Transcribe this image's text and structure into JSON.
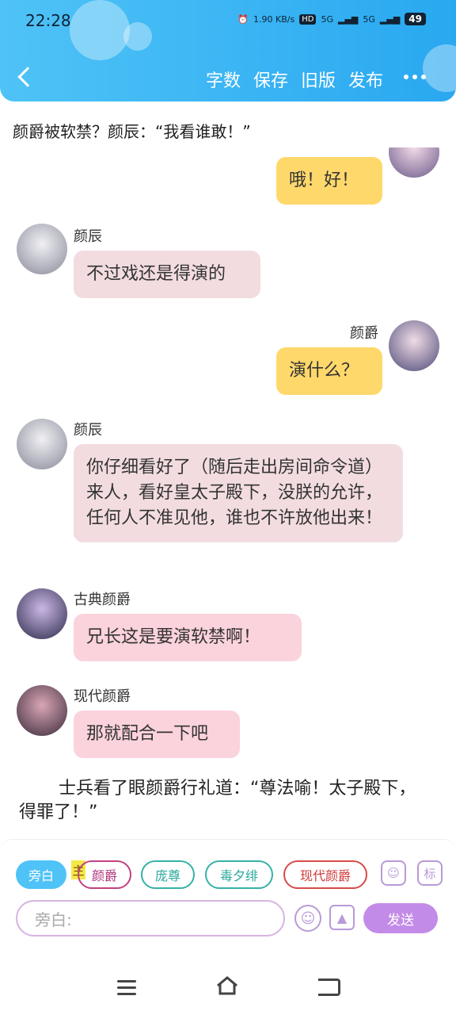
{
  "status": {
    "time": "22:28",
    "net_speed": "1.90 KB/s",
    "hd": "HD",
    "net1": "5G",
    "net2": "5G",
    "battery": "49"
  },
  "header": {
    "actions": [
      "字数",
      "保存",
      "旧版",
      "发布"
    ]
  },
  "story_title": "颜爵被软禁？颜辰：“我看谁敢！”",
  "messages": [
    {
      "side": "right",
      "name": "",
      "text": "哦！好！",
      "color": "yellow"
    },
    {
      "side": "left",
      "name": "颜辰",
      "text": "不过戏还是得演的",
      "color": "gray"
    },
    {
      "side": "right",
      "name": "颜爵",
      "text": "演什么？",
      "color": "yellow"
    },
    {
      "side": "left",
      "name": "颜辰",
      "text": "你仔细看好了（随后走出房间命令道）来人，看好皇太子殿下，没朕的允许，任何人不准见他，谁也不许放他出来！",
      "color": "gray"
    },
    {
      "side": "left",
      "name": "古典颜爵",
      "text": "兄长这是要演软禁啊！",
      "color": "pink"
    },
    {
      "side": "left",
      "name": "现代颜爵",
      "text": "那就配合一下吧",
      "color": "pink"
    }
  ],
  "narration": "士兵看了眼颜爵行礼道：“尊法喻！太子殿下，得罪了！”",
  "composer": {
    "roles": [
      "旁白",
      "颜爵",
      "庞尊",
      "毒夕绯",
      "现代颜爵"
    ],
    "main_tag": "主",
    "mark_btn": "标",
    "input_placeholder": "旁白:",
    "send_label": "发送"
  },
  "colors": {
    "header": "#29a8f0",
    "yellow_bubble": "#ffd86b",
    "gray_bubble": "#f2dcdf",
    "pink_bubble": "#fbd3dc",
    "send": "#c38be8"
  }
}
